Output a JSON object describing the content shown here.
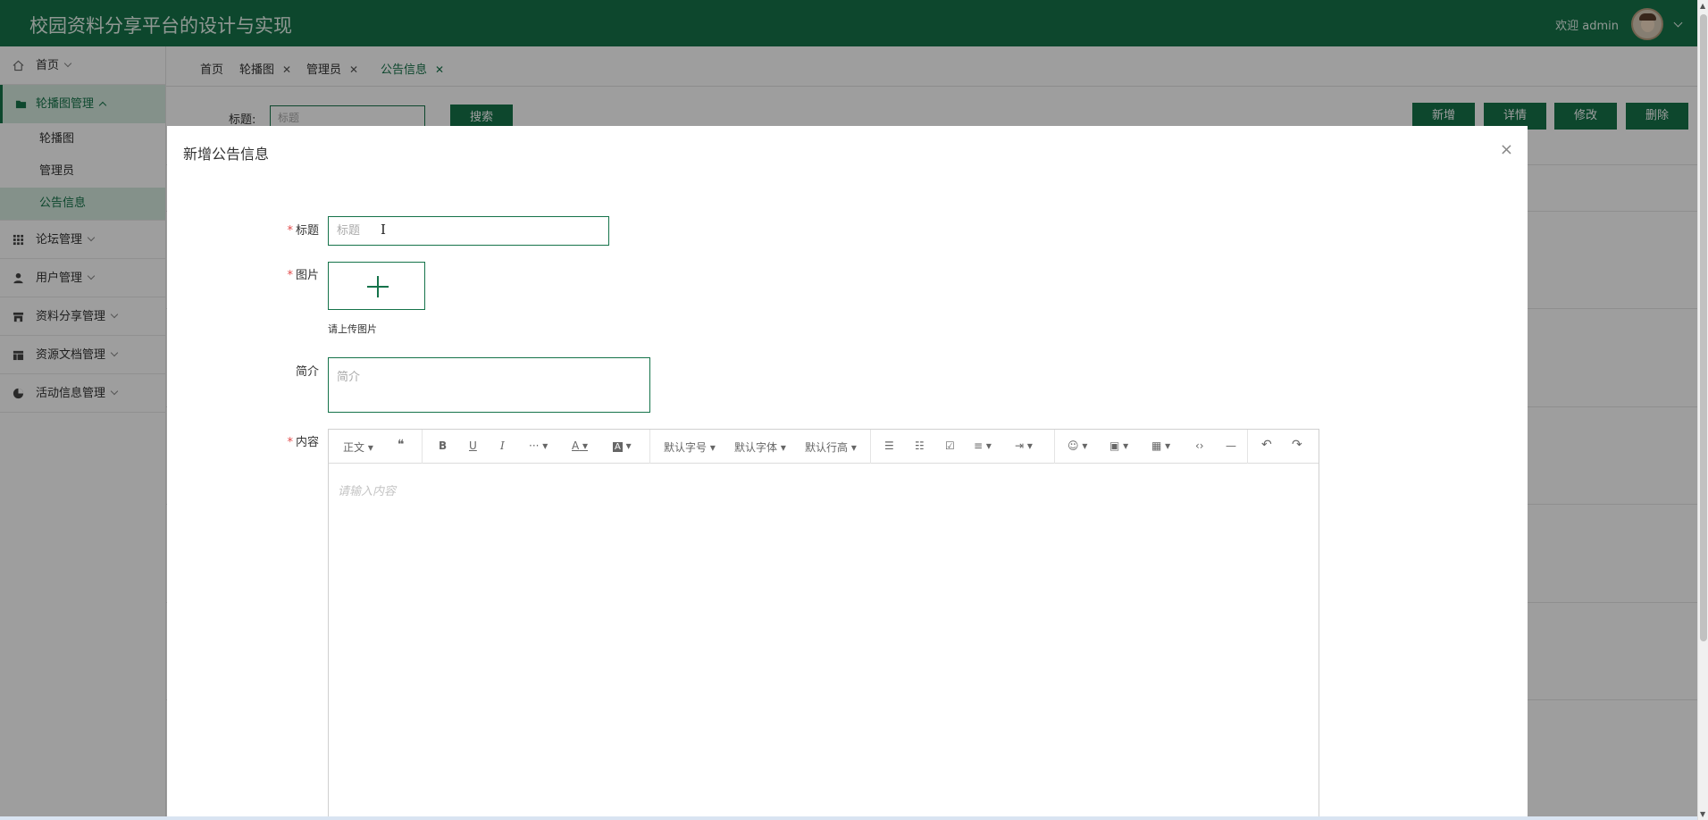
{
  "header": {
    "title": "校园资料分享平台的设计与实现",
    "welcome": "欢迎 admin"
  },
  "sidebar": {
    "items": [
      {
        "label": "首页",
        "icon": "home-icon"
      },
      {
        "label": "轮播图管理",
        "icon": "folder-icon",
        "open": true,
        "children": [
          "轮播图",
          "管理员",
          "公告信息"
        ],
        "active_child": "公告信息"
      },
      {
        "label": "论坛管理",
        "icon": "grid-icon"
      },
      {
        "label": "用户管理",
        "icon": "user-icon"
      },
      {
        "label": "资料分享管理",
        "icon": "store-icon"
      },
      {
        "label": "资源文档管理",
        "icon": "layout-icon"
      },
      {
        "label": "活动信息管理",
        "icon": "pie-icon"
      }
    ]
  },
  "tabs": [
    {
      "label": "首页",
      "closable": false
    },
    {
      "label": "轮播图",
      "closable": true
    },
    {
      "label": "管理员",
      "closable": true
    },
    {
      "label": "公告信息",
      "closable": true,
      "active": true
    }
  ],
  "search": {
    "label": "标题:",
    "placeholder": "标题",
    "button": "搜索"
  },
  "actions": {
    "add": "新增",
    "detail": "详情",
    "edit": "修改",
    "delete": "删除"
  },
  "modal": {
    "title": "新增公告信息",
    "close": "×",
    "fields": {
      "title_label": "标题",
      "title_placeholder": "标题",
      "image_label": "图片",
      "image_hint": "请上传图片",
      "intro_label": "简介",
      "intro_placeholder": "简介",
      "content_label": "内容",
      "content_placeholder": "请输入内容",
      "required_mark": "*"
    },
    "editor_toolbar": {
      "paragraph": "正文",
      "quote": "❝",
      "bold": "B",
      "underline": "U",
      "italic": "I",
      "more": "···",
      "font_color": "A",
      "bg_color": "A",
      "font_size": "默认字号",
      "font_family": "默认字体",
      "line_height": "默认行高",
      "bullet_list": "☰",
      "numbered_list": "☷",
      "todo": "☑",
      "align": "≡",
      "indent": "⇥",
      "emoji": "☺",
      "image": "▣",
      "table": "▦",
      "code": "‹›",
      "divider": "—",
      "undo": "↶",
      "redo": "↷"
    }
  },
  "colors": {
    "primary": "#15734a",
    "primary_light": "#d6eadf",
    "required": "#e24b4b"
  }
}
